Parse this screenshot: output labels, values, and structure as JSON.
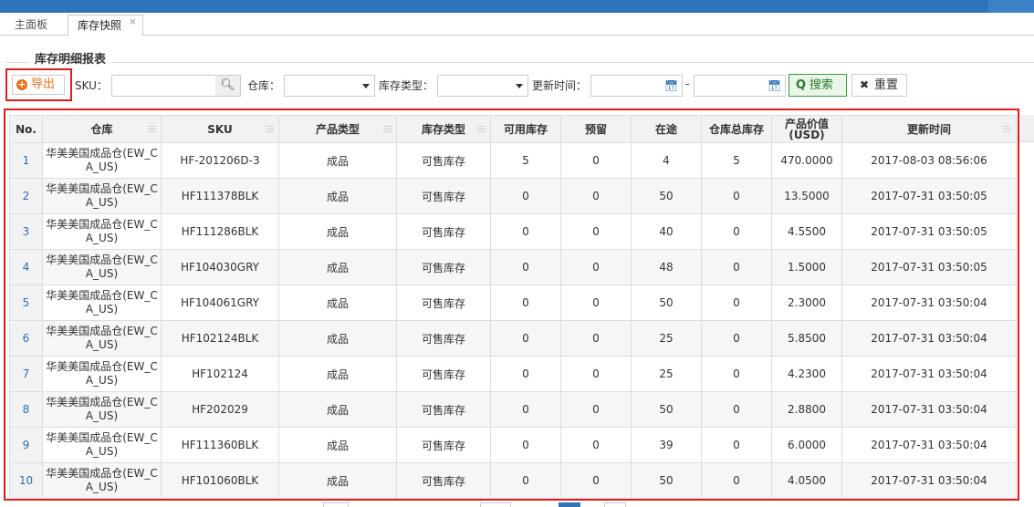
{
  "tabs": [
    {
      "label": "主面板"
    },
    {
      "label": "库存快照",
      "close": "×"
    }
  ],
  "section": {
    "title": "库存明细报表"
  },
  "toolbar": {
    "export_label": "导出",
    "sku_label": "SKU：",
    "sku_value": "",
    "warehouse_label": "仓库：",
    "warehouse_value": "",
    "stock_type_label": "库存类型：",
    "stock_type_value": "",
    "update_time_label": "更新时间：",
    "date_from": "",
    "date_sep": "-",
    "date_to": "",
    "search_label": "搜索",
    "reset_label": "重置"
  },
  "table": {
    "headers": [
      "No.",
      "仓库",
      "SKU",
      "产品类型",
      "库存类型",
      "可用库存",
      "预留",
      "在途",
      "仓库总库存",
      "产品价值(USD)",
      "更新时间"
    ],
    "rows": [
      {
        "no": "1",
        "warehouse": "华美美国成品仓(EW_CA_US)",
        "sku": "HF-201206D-3",
        "product_type": "成品",
        "stock_type": "可售库存",
        "available": "5",
        "reserved": "0",
        "in_transit": "4",
        "total": "5",
        "value": "470.0000",
        "updated": "2017-08-03 08:56:06"
      },
      {
        "no": "2",
        "warehouse": "华美美国成品仓(EW_CA_US)",
        "sku": "HF111378BLK",
        "product_type": "成品",
        "stock_type": "可售库存",
        "available": "0",
        "reserved": "0",
        "in_transit": "50",
        "total": "0",
        "value": "13.5000",
        "updated": "2017-07-31 03:50:05"
      },
      {
        "no": "3",
        "warehouse": "华美美国成品仓(EW_CA_US)",
        "sku": "HF111286BLK",
        "product_type": "成品",
        "stock_type": "可售库存",
        "available": "0",
        "reserved": "0",
        "in_transit": "40",
        "total": "0",
        "value": "4.5500",
        "updated": "2017-07-31 03:50:05"
      },
      {
        "no": "4",
        "warehouse": "华美美国成品仓(EW_CA_US)",
        "sku": "HF104030GRY",
        "product_type": "成品",
        "stock_type": "可售库存",
        "available": "0",
        "reserved": "0",
        "in_transit": "48",
        "total": "0",
        "value": "1.5000",
        "updated": "2017-07-31 03:50:05"
      },
      {
        "no": "5",
        "warehouse": "华美美国成品仓(EW_CA_US)",
        "sku": "HF104061GRY",
        "product_type": "成品",
        "stock_type": "可售库存",
        "available": "0",
        "reserved": "0",
        "in_transit": "50",
        "total": "0",
        "value": "2.3000",
        "updated": "2017-07-31 03:50:04"
      },
      {
        "no": "6",
        "warehouse": "华美美国成品仓(EW_CA_US)",
        "sku": "HF102124BLK",
        "product_type": "成品",
        "stock_type": "可售库存",
        "available": "0",
        "reserved": "0",
        "in_transit": "25",
        "total": "0",
        "value": "5.8500",
        "updated": "2017-07-31 03:50:04"
      },
      {
        "no": "7",
        "warehouse": "华美美国成品仓(EW_CA_US)",
        "sku": "HF102124",
        "product_type": "成品",
        "stock_type": "可售库存",
        "available": "0",
        "reserved": "0",
        "in_transit": "25",
        "total": "0",
        "value": "4.2300",
        "updated": "2017-07-31 03:50:04"
      },
      {
        "no": "8",
        "warehouse": "华美美国成品仓(EW_CA_US)",
        "sku": "HF202029",
        "product_type": "成品",
        "stock_type": "可售库存",
        "available": "0",
        "reserved": "0",
        "in_transit": "50",
        "total": "0",
        "value": "2.8800",
        "updated": "2017-07-31 03:50:04"
      },
      {
        "no": "9",
        "warehouse": "华美美国成品仓(EW_CA_US)",
        "sku": "HF111360BLK",
        "product_type": "成品",
        "stock_type": "可售库存",
        "available": "0",
        "reserved": "0",
        "in_transit": "39",
        "total": "0",
        "value": "6.0000",
        "updated": "2017-07-31 03:50:04"
      },
      {
        "no": "10",
        "warehouse": "华美美国成品仓(EW_CA_US)",
        "sku": "HF101060BLK",
        "product_type": "成品",
        "stock_type": "可售库存",
        "available": "0",
        "reserved": "0",
        "in_transit": "50",
        "total": "0",
        "value": "4.0500",
        "updated": "2017-07-31 03:50:04"
      }
    ]
  },
  "colors": {
    "topbar": "#2f73b8",
    "highlight_border": "#d9201f",
    "export_accent": "#e8701e",
    "search_green": "#2a7a2a",
    "link_blue": "#2a6db5"
  }
}
